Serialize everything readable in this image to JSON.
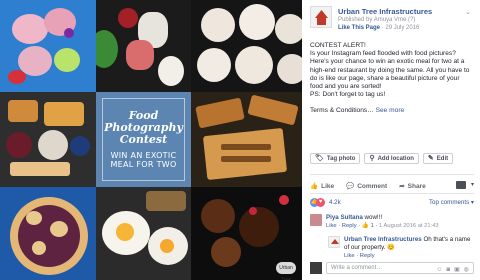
{
  "collage": {
    "center_title": "Food\nPhotography\nContest",
    "center_subtitle": "WIN AN EXOTIC\nMEAL FOR TWO",
    "watermark": "Urban Tree"
  },
  "post": {
    "page_name": "Urban Tree Infrastructures",
    "published_by": "Published by Amuya Vme (?)",
    "like_page": "Like This Page",
    "date": "29 July 2016",
    "paragraph1": "CONTEST ALERT!",
    "paragraph2": "Is your Instagram feed flooded with food pictures? Here's your chance to win an exotic meal for two at a high-end restaurant by doing the same. All you have to do is like our page, share a beautiful picture of your food and you are sorted!",
    "paragraph3": "PS: Don't forget to tag us!",
    "terms": "Terms & Conditions…",
    "see_more": "See more"
  },
  "tagging": {
    "tag_photo": "Tag photo",
    "add_location": "Add location",
    "edit": "Edit"
  },
  "actions": {
    "like": "Like",
    "comment": "Comment",
    "share": "Share"
  },
  "reactions": {
    "count": "4.2k",
    "top_comments": "Top comments ▾"
  },
  "comments": [
    {
      "name": "Piya Sultana",
      "text": "wow!!!",
      "like": "Like",
      "reply": "Reply",
      "likes": "1",
      "time": "1 August 2016 at 21:43"
    },
    {
      "name": "Urban Tree Infrastructures",
      "text": "Oh that's a name of our property.",
      "emoji": "😊",
      "like": "Like",
      "reply": "Reply"
    }
  ],
  "write_comment": {
    "placeholder": "Write a comment…"
  },
  "colors": {
    "facebook_blue": "#365899",
    "collage_center": "#5d85b2"
  }
}
